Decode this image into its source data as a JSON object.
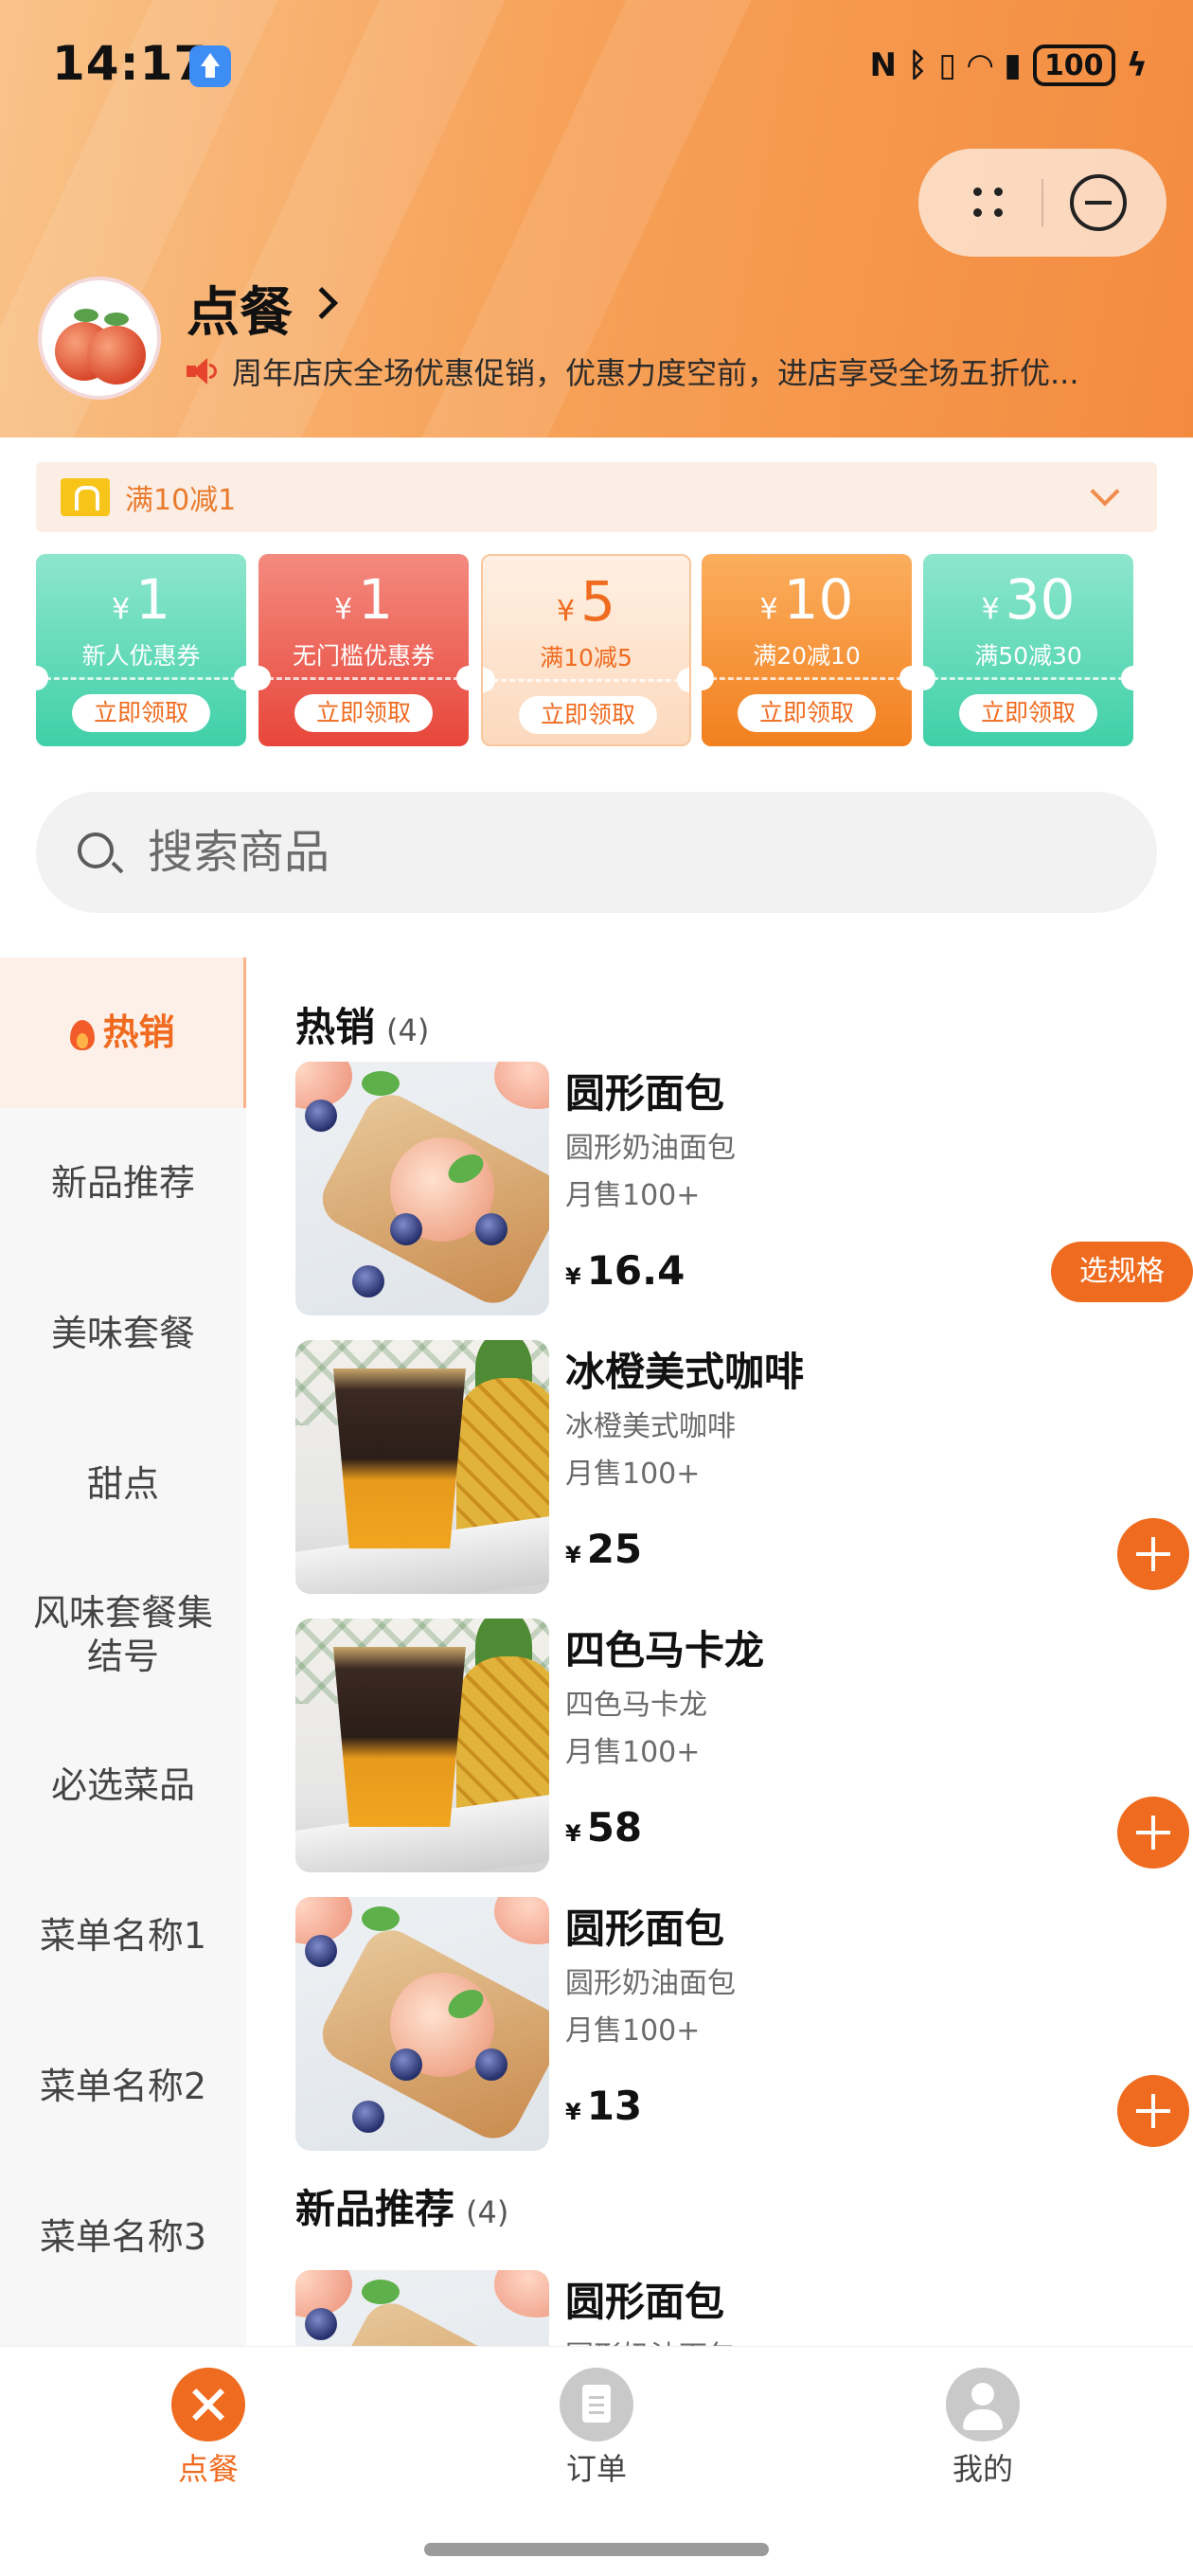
{
  "status_bar": {
    "time": "14:17",
    "battery": "100"
  },
  "header": {
    "store_name": "点餐",
    "notice": "周年店庆全场优惠促销，优惠力度空前，进店享受全场五折优..."
  },
  "promo": {
    "text": "满10减1"
  },
  "coupons": [
    {
      "currency": "¥",
      "amount": "1",
      "desc": "新人优惠券",
      "button": "立即领取",
      "bg": "#4fd8b4",
      "text_color": "#ffffff"
    },
    {
      "currency": "¥",
      "amount": "1",
      "desc": "无门槛优惠券",
      "button": "立即领取",
      "bg": "#ef5a4a",
      "text_color": "#ffffff"
    },
    {
      "currency": "¥",
      "amount": "5",
      "desc": "满10减5",
      "button": "立即领取",
      "bg": "#fde0c7",
      "text_color": "#ef6b1f"
    },
    {
      "currency": "¥",
      "amount": "10",
      "desc": "满20减10",
      "button": "立即领取",
      "bg": "#f6902f",
      "text_color": "#ffffff"
    },
    {
      "currency": "¥",
      "amount": "30",
      "desc": "满50减30",
      "button": "立即领取",
      "bg": "#4fd8b4",
      "text_color": "#ffffff"
    }
  ],
  "search": {
    "placeholder": "搜索商品"
  },
  "sidebar": {
    "items": [
      {
        "label": "热销",
        "active": true
      },
      {
        "label": "新品推荐"
      },
      {
        "label": "美味套餐"
      },
      {
        "label": "甜点"
      },
      {
        "label": "风味套餐集结号"
      },
      {
        "label": "必选菜品"
      },
      {
        "label": "菜单名称1"
      },
      {
        "label": "菜单名称2"
      },
      {
        "label": "菜单名称3"
      }
    ]
  },
  "sections": [
    {
      "title": "热销",
      "count": "(4)",
      "products": [
        {
          "name": "圆形面包",
          "desc": "圆形奶油面包",
          "sales": "月售100+",
          "currency": "¥",
          "price": "16.4",
          "action": "选规格",
          "image": "bread"
        },
        {
          "name": "冰橙美式咖啡",
          "desc": "冰橙美式咖啡",
          "sales": "月售100+",
          "currency": "¥",
          "price": "25",
          "action": "add",
          "image": "coffee"
        },
        {
          "name": "四色马卡龙",
          "desc": "四色马卡龙",
          "sales": "月售100+",
          "currency": "¥",
          "price": "58",
          "action": "add",
          "image": "coffee"
        },
        {
          "name": "圆形面包",
          "desc": "圆形奶油面包",
          "sales": "月售100+",
          "currency": "¥",
          "price": "13",
          "action": "add",
          "image": "bread"
        }
      ]
    },
    {
      "title": "新品推荐",
      "count": "(4)",
      "products": [
        {
          "name": "圆形面包",
          "desc": "圆形奶油面包",
          "image": "bread"
        }
      ]
    }
  ],
  "bottom_nav": [
    {
      "label": "点餐",
      "icon": "utensils-icon",
      "active": true
    },
    {
      "label": "订单",
      "icon": "clipboard-icon"
    },
    {
      "label": "我的",
      "icon": "user-icon"
    }
  ],
  "colors": {
    "accent": "#ef6b1f",
    "header_gradient_start": "#f9c38a",
    "header_gradient_end": "#f38b3f"
  }
}
